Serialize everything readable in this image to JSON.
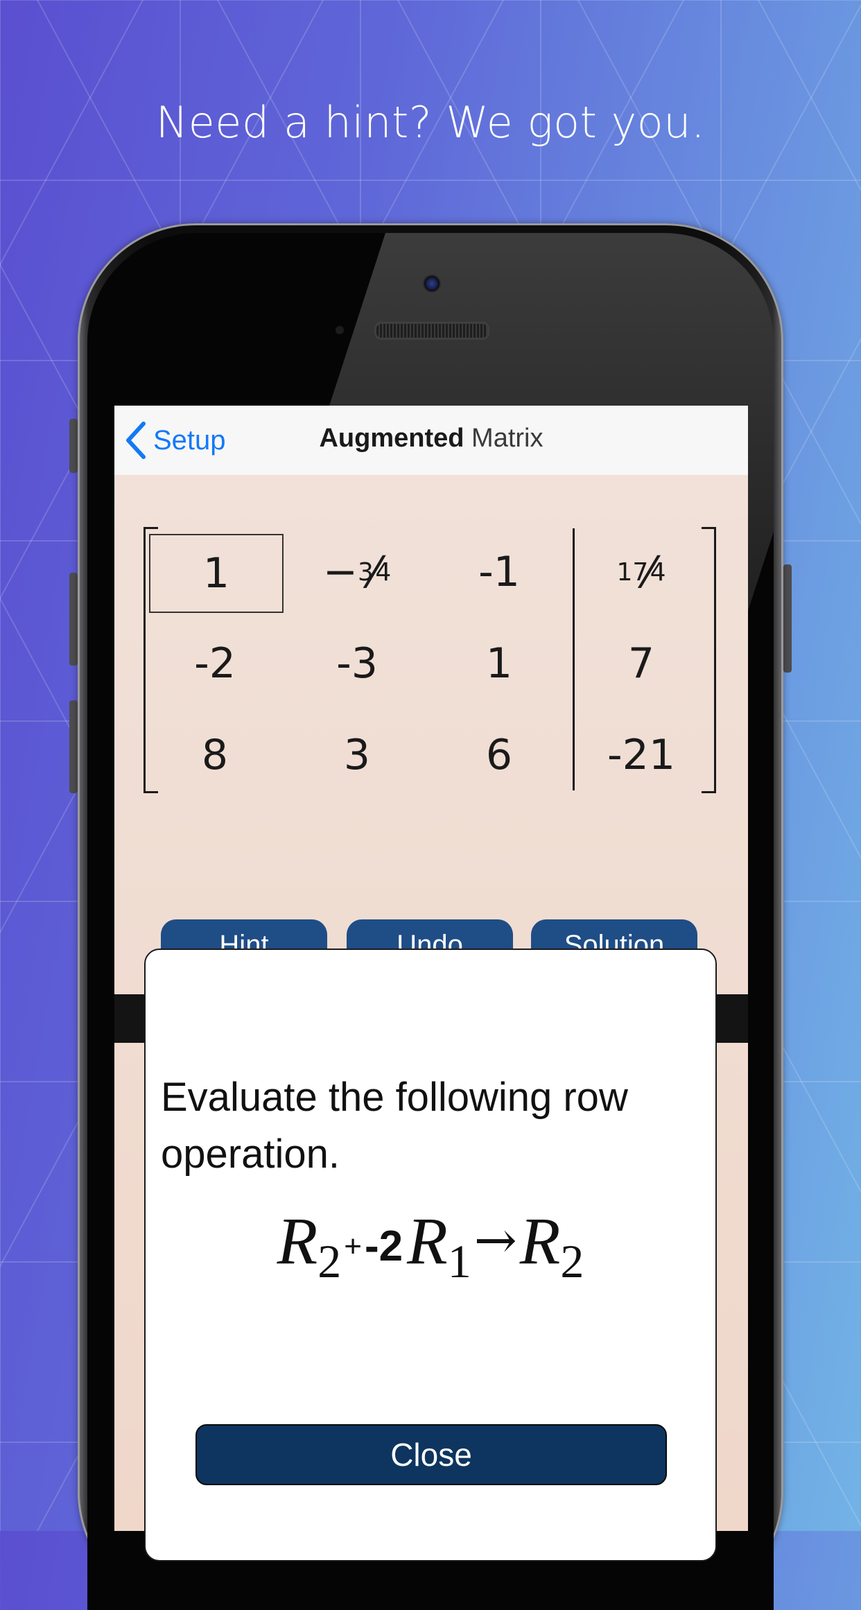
{
  "promo": {
    "headline": "Need a hint? We got you."
  },
  "nav": {
    "back_label": "Setup",
    "title_bold": "Augmented",
    "title_rest": "Matrix"
  },
  "matrix": {
    "rows": [
      [
        "1",
        "−3/4",
        "-1",
        "17/4"
      ],
      [
        "-2",
        "-3",
        "1",
        "7"
      ],
      [
        "8",
        "3",
        "6",
        "-21"
      ]
    ],
    "selected_cell": "row1-col1"
  },
  "toolbar": {
    "buttons": [
      "Hint",
      "Undo",
      "Solution"
    ]
  },
  "hint_modal": {
    "message": "Evaluate the following row operation.",
    "formula": {
      "target": "R",
      "target_sub": "2",
      "plus": "+",
      "coefficient": "-2",
      "source": "R",
      "source_sub": "1",
      "arrow": "→",
      "result": "R",
      "result_sub": "2"
    },
    "close_label": "Close"
  },
  "colors": {
    "accent_blue": "#1479f6",
    "button_navy": "#0e355f",
    "tab_blue": "#1f4d86",
    "matrix_bg": "#efd6c8"
  }
}
